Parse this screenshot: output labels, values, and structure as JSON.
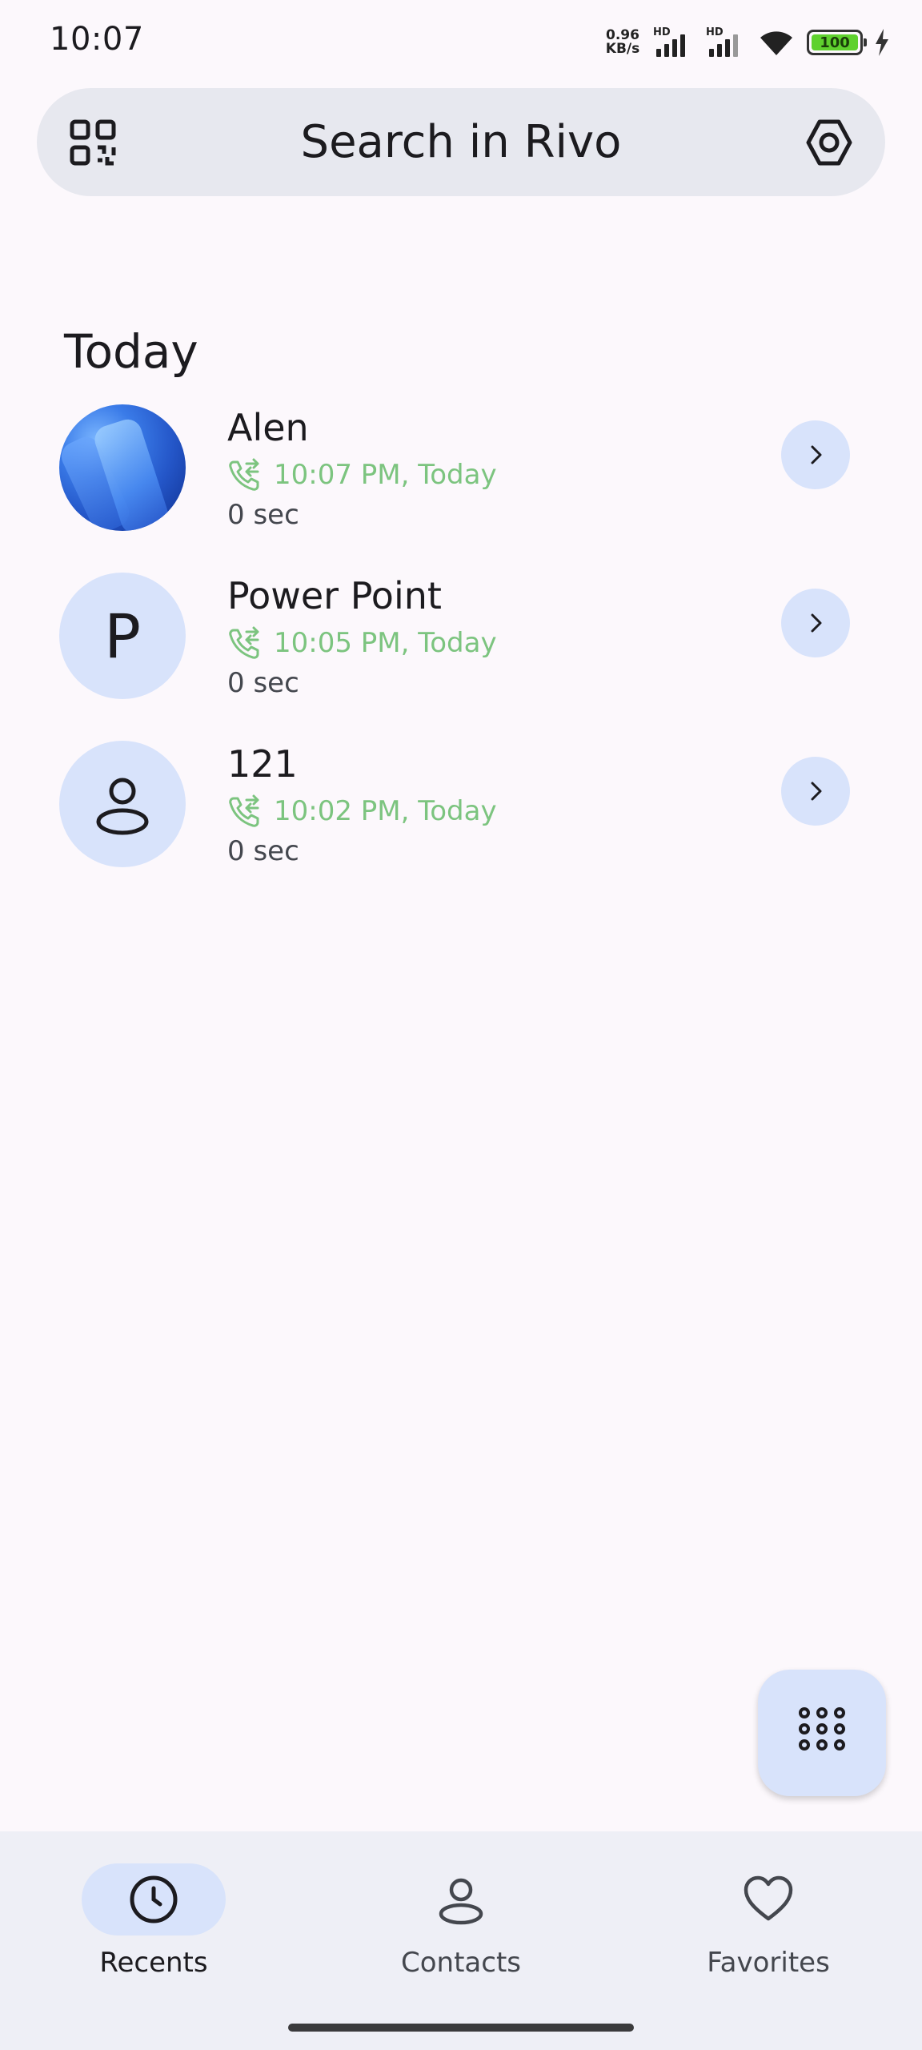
{
  "status_bar": {
    "time": "10:07",
    "net_speed_value": "0.96",
    "net_speed_unit": "KB/s",
    "signal1_label": "HD",
    "signal2_label": "HD",
    "battery": "100",
    "icons": [
      "wifi-icon",
      "charging-icon"
    ]
  },
  "search": {
    "placeholder": "Search in Rivo",
    "left_icon": "qr-code-icon",
    "right_icon": "settings-icon"
  },
  "recents": {
    "section_title": "Today",
    "calls": [
      {
        "name": "Alen",
        "time": "10:07 PM, Today",
        "duration": "0 sec",
        "avatar_type": "photo",
        "avatar_letter": ""
      },
      {
        "name": "Power Point",
        "time": "10:05 PM, Today",
        "duration": "0 sec",
        "avatar_type": "letter",
        "avatar_letter": "P"
      },
      {
        "name": "121",
        "time": "10:02 PM, Today",
        "duration": "0 sec",
        "avatar_type": "person",
        "avatar_letter": ""
      }
    ]
  },
  "fab": {
    "icon": "dialpad-icon"
  },
  "bottom_nav": {
    "items": [
      {
        "label": "Recents",
        "icon": "clock-icon",
        "active": true
      },
      {
        "label": "Contacts",
        "icon": "person-icon",
        "active": false
      },
      {
        "label": "Favorites",
        "icon": "heart-icon",
        "active": false
      }
    ]
  },
  "colors": {
    "accent_container": "#d8e3fb",
    "call_time_green": "#7cc47f",
    "background": "#fcf8fc"
  }
}
